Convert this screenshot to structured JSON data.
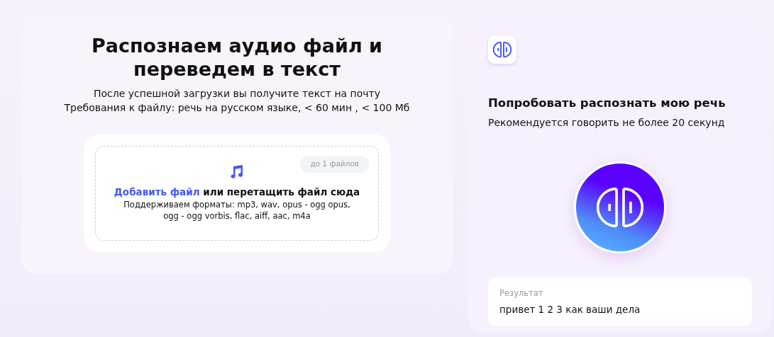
{
  "upload_section": {
    "title": "Распознаем аудио файл и переведем в текст",
    "subtitle_lines": [
      "После успешной загрузки вы получите текст на почту",
      "Требования к файлу: речь на русском языке, < 60 мин , < 100 Мб"
    ],
    "dropzone": {
      "limit_badge": "до 1 файлов",
      "add_link": "Добавить файл",
      "drop_text": "или перетащить файл сюда",
      "formats": "Поддерживаем форматы: mp3, wav, opus - ogg opus, ogg - ogg vorbis, flac, aiff, aac, m4a"
    }
  },
  "speech_section": {
    "title": "Попробовать распознать мою речь",
    "hint": "Рекомендуется говорить не более 20 секунд",
    "result": {
      "label": "Результат",
      "text": "привет 1 2 3 как ваши дела"
    }
  }
}
